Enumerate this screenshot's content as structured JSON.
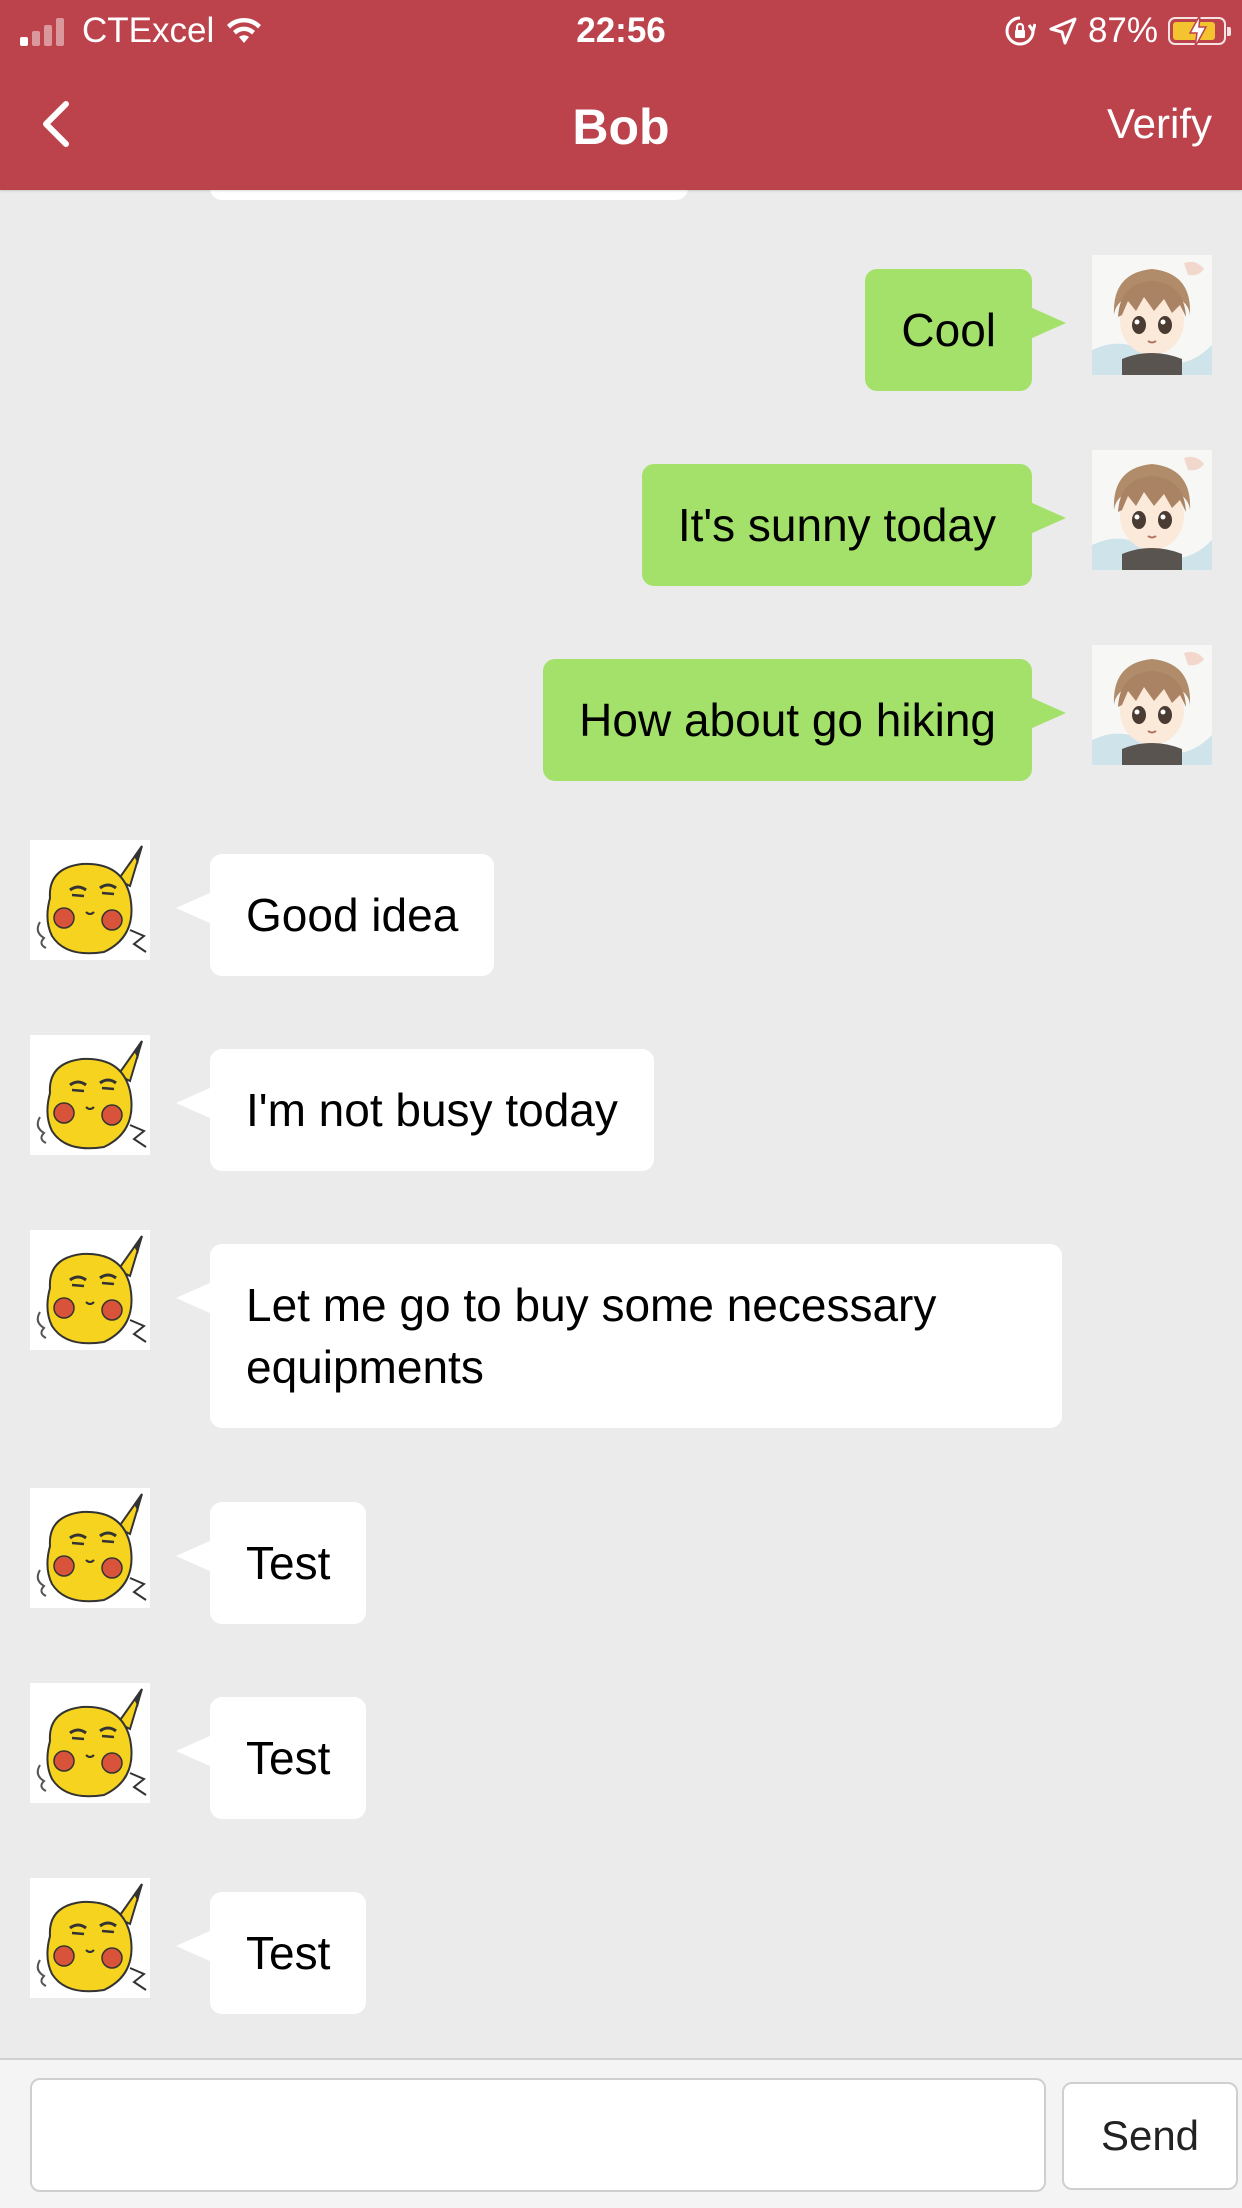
{
  "status_bar": {
    "carrier": "CTExcel",
    "time": "22:56",
    "battery_percent": "87%",
    "battery_level": 0.87,
    "icons": [
      "signal-icon",
      "wifi-icon",
      "orientation-lock-icon",
      "location-arrow-icon",
      "battery-icon"
    ]
  },
  "header": {
    "back_icon": "chevron-left-icon",
    "title": "Bob",
    "verify_label": "Verify"
  },
  "colors": {
    "header_bg": "#bc434c",
    "chat_bg": "#ebebeb",
    "outgoing_bubble": "#a4e16a",
    "incoming_bubble": "#ffffff"
  },
  "messages": [
    {
      "direction": "out",
      "text": "Cool",
      "avatar": "anime-boy-avatar"
    },
    {
      "direction": "out",
      "text": "It's sunny today",
      "avatar": "anime-boy-avatar"
    },
    {
      "direction": "out",
      "text": "How about go hiking",
      "avatar": "anime-boy-avatar"
    },
    {
      "direction": "in",
      "text": "Good idea",
      "avatar": "pikachu-avatar"
    },
    {
      "direction": "in",
      "text": "I'm not busy today",
      "avatar": "pikachu-avatar"
    },
    {
      "direction": "in",
      "text": "Let me go to buy some necessary equipments",
      "avatar": "pikachu-avatar"
    },
    {
      "direction": "in",
      "text": "Test",
      "avatar": "pikachu-avatar"
    },
    {
      "direction": "in",
      "text": "Test",
      "avatar": "pikachu-avatar"
    },
    {
      "direction": "in",
      "text": "Test",
      "avatar": "pikachu-avatar"
    }
  ],
  "composer": {
    "input_value": "",
    "placeholder": "",
    "send_label": "Send"
  }
}
